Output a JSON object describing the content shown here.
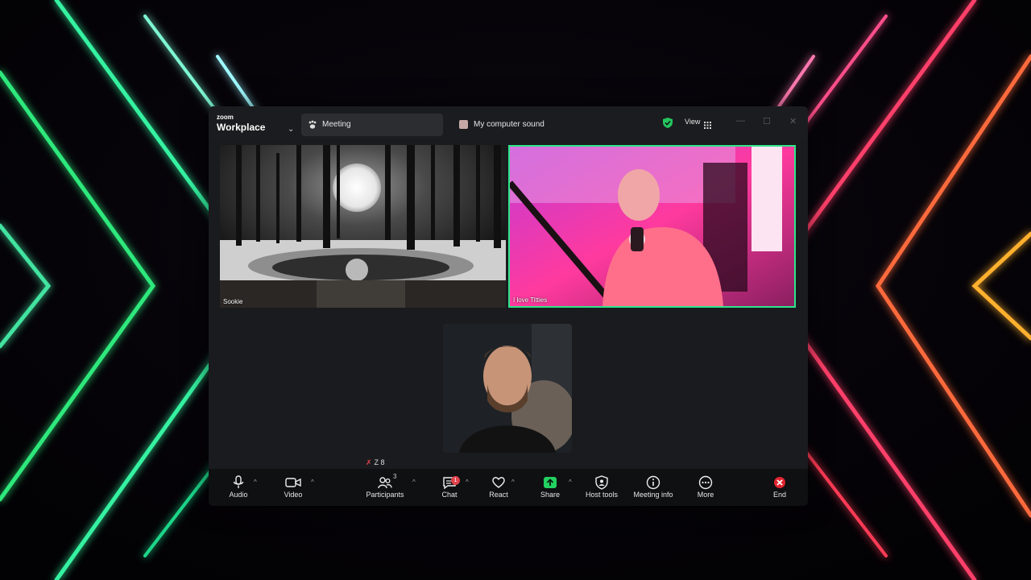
{
  "window": {
    "brand_small": "zoom",
    "brand_big": "Workplace",
    "tabs": [
      {
        "label": "Meeting",
        "icon": "paw-icon"
      },
      {
        "label": "My computer sound",
        "icon": "sound-tab-icon"
      }
    ],
    "view_label": "View",
    "minimize": "—",
    "maximize": "☐",
    "close": "✕"
  },
  "participants": [
    {
      "name": "Sookie"
    },
    {
      "name": "I love Titties"
    }
  ],
  "muted_indicator": "Z 8",
  "toolbar": {
    "items": [
      {
        "label": "Audio",
        "icon": "microphone-icon"
      },
      {
        "label": "Video",
        "icon": "video-camera-icon"
      },
      {
        "label": "Participants",
        "icon": "participants-icon"
      },
      {
        "label": "Chat",
        "icon": "chat-icon"
      },
      {
        "label": "React",
        "icon": "heart-icon"
      },
      {
        "label": "Share",
        "icon": "share-icon"
      },
      {
        "label": "Host tools",
        "icon": "host-tools-shield-icon"
      },
      {
        "label": "Meeting info",
        "icon": "info-icon"
      },
      {
        "label": "More",
        "icon": "more-icon"
      },
      {
        "label": "End",
        "icon": "end-call-icon"
      }
    ],
    "participants_count": "3",
    "chat_badge": "1"
  },
  "colors": {
    "share_green": "#23d160",
    "speaker_border": "#2ee58a",
    "end_red": "#e0242f",
    "window_bg": "#1b1c1f"
  }
}
